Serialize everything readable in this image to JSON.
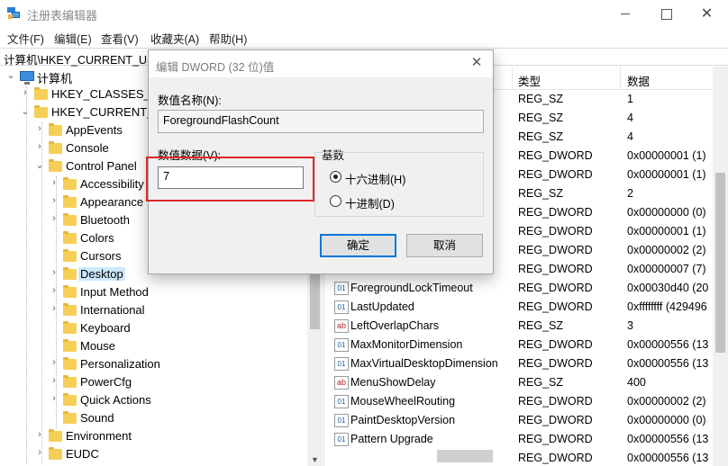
{
  "window": {
    "title": "注册表编辑器",
    "close_glyph": "✕"
  },
  "menu": [
    "文件(F)",
    "编辑(E)",
    "查看(V)",
    "收藏夹(A)",
    "帮助(H)"
  ],
  "address": "计算机\\HKEY_CURRENT_USE",
  "tree": {
    "root": "计算机",
    "nodes": [
      {
        "label": "HKEY_CLASSES_RO",
        "expanded": false
      },
      {
        "label": "HKEY_CURRENT_U",
        "expanded": true
      },
      {
        "label": "AppEvents",
        "expanded": false
      },
      {
        "label": "Console",
        "expanded": false
      },
      {
        "label": "Control Panel",
        "expanded": true
      },
      {
        "label": "Accessibility",
        "expanded": false
      },
      {
        "label": "Appearance",
        "expanded": false
      },
      {
        "label": "Bluetooth",
        "expanded": false
      },
      {
        "label": "Colors",
        "expanded": false
      },
      {
        "label": "Cursors",
        "expanded": false
      },
      {
        "label": "Desktop",
        "expanded": false,
        "selected": true
      },
      {
        "label": "Input Method",
        "expanded": false
      },
      {
        "label": "International",
        "expanded": false
      },
      {
        "label": "Keyboard",
        "expanded": false
      },
      {
        "label": "Mouse",
        "expanded": false
      },
      {
        "label": "Personalization",
        "expanded": false
      },
      {
        "label": "PowerCfg",
        "expanded": false
      },
      {
        "label": "Quick Actions",
        "expanded": false
      },
      {
        "label": "Sound",
        "expanded": false
      },
      {
        "label": "Environment",
        "expanded": false
      },
      {
        "label": "EUDC",
        "expanded": false
      }
    ]
  },
  "list": {
    "columns": {
      "type": "类型",
      "data": "数据"
    },
    "rows": [
      {
        "name": "",
        "type": "REG_SZ",
        "data": "1"
      },
      {
        "name": "",
        "type": "REG_SZ",
        "data": "4"
      },
      {
        "name": "",
        "type": "REG_SZ",
        "data": "4"
      },
      {
        "name": "",
        "type": "REG_DWORD",
        "data": "0x00000001 (1)"
      },
      {
        "name": "",
        "type": "REG_DWORD",
        "data": "0x00000001 (1)"
      },
      {
        "name": "",
        "type": "REG_SZ",
        "data": "2"
      },
      {
        "name": "",
        "type": "REG_DWORD",
        "data": "0x00000000 (0)"
      },
      {
        "name": "",
        "type": "REG_DWORD",
        "data": "0x00000001 (1)"
      },
      {
        "name": "",
        "type": "REG_DWORD",
        "data": "0x00000002 (2)"
      },
      {
        "name": "",
        "type": "REG_DWORD",
        "data": "0x00000007 (7)"
      },
      {
        "name": "ForegroundLockTimeout",
        "type": "REG_DWORD",
        "data": "0x00030d40 (20"
      },
      {
        "name": "LastUpdated",
        "type": "REG_DWORD",
        "data": "0xffffffff (429496"
      },
      {
        "name": "LeftOverlapChars",
        "type": "REG_SZ",
        "data": "3"
      },
      {
        "name": "MaxMonitorDimension",
        "type": "REG_DWORD",
        "data": "0x00000556 (13"
      },
      {
        "name": "MaxVirtualDesktopDimension",
        "type": "REG_DWORD",
        "data": "0x00000556 (13"
      },
      {
        "name": "MenuShowDelay",
        "type": "REG_SZ",
        "data": "400"
      },
      {
        "name": "MouseWheelRouting",
        "type": "REG_DWORD",
        "data": "0x00000002 (2)"
      },
      {
        "name": "PaintDesktopVersion",
        "type": "REG_DWORD",
        "data": "0x00000000 (0)"
      },
      {
        "name": "Pattern Upgrade",
        "type": "REG_DWORD",
        "data": "0x00000556 (13"
      },
      {
        "name": "",
        "type": "REG_DWORD",
        "data": "0x00000556 (13"
      }
    ]
  },
  "dialog": {
    "title": "编辑 DWORD (32 位)值",
    "name_label": "数值名称(N):",
    "value_name": "ForegroundFlashCount",
    "data_label": "数值数据(V):",
    "data_value": "7",
    "base_label": "基数",
    "hex_label": "十六进制(H)",
    "dec_label": "十进制(D)",
    "selected_base": "hex",
    "ok_label": "确定",
    "cancel_label": "取消"
  },
  "colors": {
    "highlight_border": "#e0262b",
    "selection": "#cce8ff",
    "default_button_border": "#0078d7"
  }
}
